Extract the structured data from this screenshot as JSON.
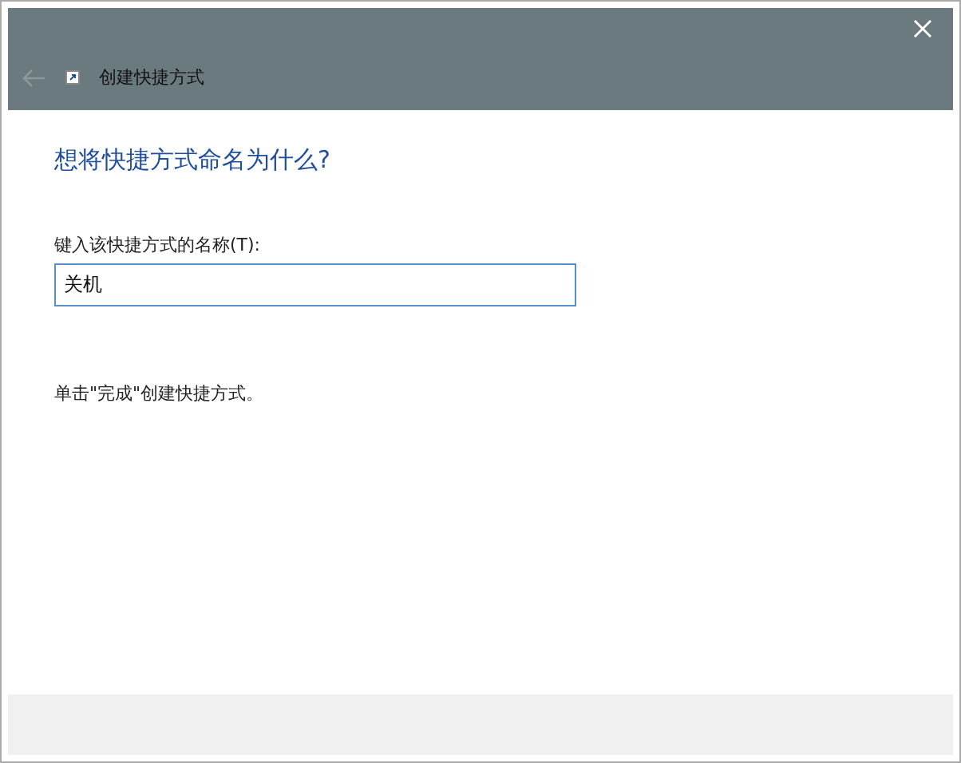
{
  "window": {
    "title": "创建快捷方式",
    "back_button": {
      "disabled": true
    }
  },
  "heading": "想将快捷方式命名为什么?",
  "name_field": {
    "label": "键入该快捷方式的名称(T):",
    "value": "关机",
    "focused": true
  },
  "hint": "单击\"完成\"创建快捷方式。"
}
